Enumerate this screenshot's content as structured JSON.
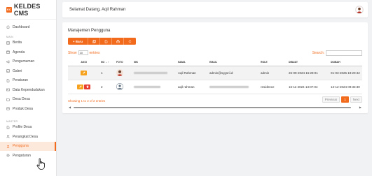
{
  "brand": {
    "logo_text": "KC",
    "name": "KELDES CMS"
  },
  "sidebar": {
    "dashboard": "Dashboard",
    "main_label": "MAIN",
    "main_items": [
      "Berita",
      "Agenda",
      "Pengumuman",
      "Galeri",
      "Peraturan",
      "Data Kependudukan",
      "Desa Desa",
      "Produk Desa"
    ],
    "master_label": "MASTER",
    "master_items": [
      "Profile Desa",
      "Perangkat Desa",
      "Pengguna",
      "Pengaturan"
    ],
    "active_item": "Pengguna"
  },
  "topbar": {
    "greeting": "Selamat Datang, Aqil Rahman"
  },
  "panel": {
    "title": "Manajemen Pengguna",
    "toolbar": {
      "new_label": "+ Baru",
      "icons": [
        "copy-icon",
        "file-icon",
        "print-icon",
        "refresh-icon"
      ]
    },
    "show_label": "Show",
    "show_value": "10",
    "entries_label": "entries",
    "search_label": "Search:",
    "search_value": ""
  },
  "table": {
    "headers": [
      "AKSI",
      "NO",
      "FOTO",
      "NIK",
      "NAMA",
      "EMAIL",
      "ROLE",
      "DIBUAT",
      "DIUBAH"
    ],
    "rows": [
      {
        "no": "1",
        "nama": "Aqil Rahman",
        "email": "admin@sygsri.id",
        "role": "admin",
        "dibuat": "26-09-2024 15:28:01",
        "diubah": "01-03-2025 19:20:42",
        "actions": [
          "edit"
        ]
      },
      {
        "no": "2",
        "nama": "aqil rahman",
        "email": "",
        "role": "residence",
        "dibuat": "16-11-2024 13:07:04",
        "diubah": "13-12-2024 09:33:30",
        "actions": [
          "edit",
          "delete"
        ]
      }
    ]
  },
  "footer": {
    "info": "Showing 1 to 2 of 2 entries",
    "previous": "Previous",
    "page": "1",
    "next": "Next"
  },
  "colors": {
    "accent": "#f26b1d",
    "edit": "#f6a21e",
    "delete": "#e63b2e"
  }
}
